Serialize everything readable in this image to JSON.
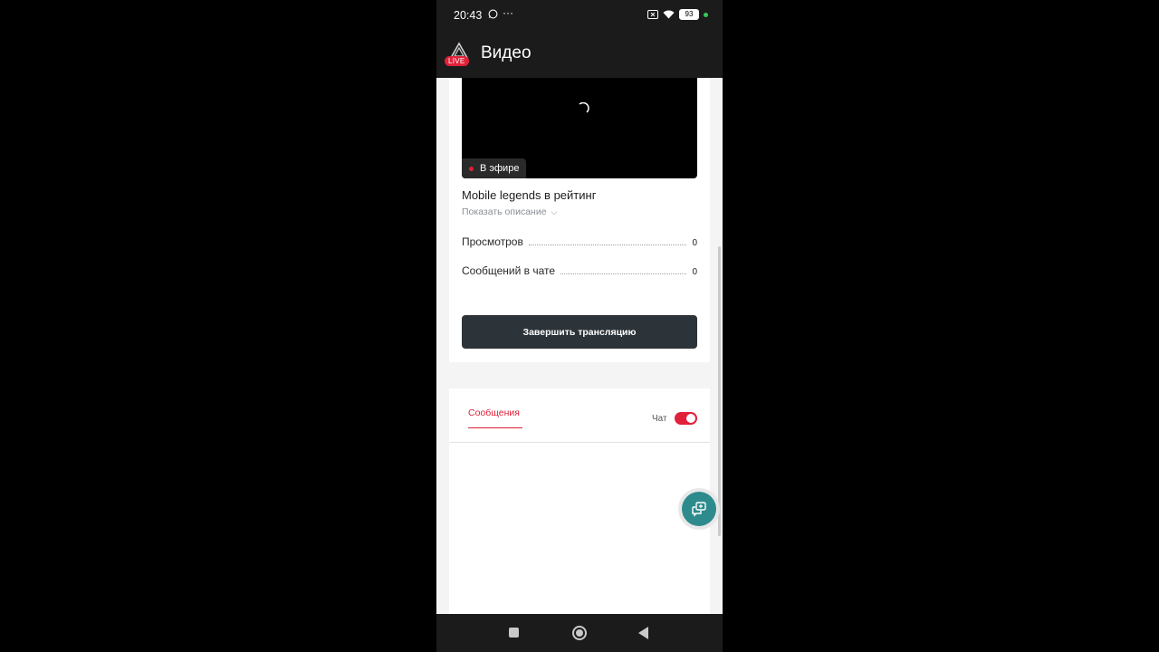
{
  "status_bar": {
    "time": "20:43",
    "dots": "···",
    "battery": "93",
    "icons": [
      "whatsapp-icon",
      "screen-record-icon",
      "wifi-icon",
      "battery-icon"
    ]
  },
  "app_bar": {
    "title": "Видео",
    "badge": "LIVE",
    "accent": "#e0213a"
  },
  "player": {
    "live_label": "В эфире"
  },
  "stream": {
    "title": "Mobile legends в рейтинг",
    "show_description": "Показать описание"
  },
  "stats": [
    {
      "label": "Просмотров",
      "value": "0"
    },
    {
      "label": "Сообщений в чате",
      "value": "0"
    }
  ],
  "end_button": "Завершить трансляцию",
  "chat": {
    "tab_messages": "Сообщения",
    "toggle_label": "Чат",
    "toggle_on": true
  },
  "colors": {
    "accent": "#e0213a",
    "button_dark": "#2d3439",
    "fab": "#2e8b8d"
  }
}
